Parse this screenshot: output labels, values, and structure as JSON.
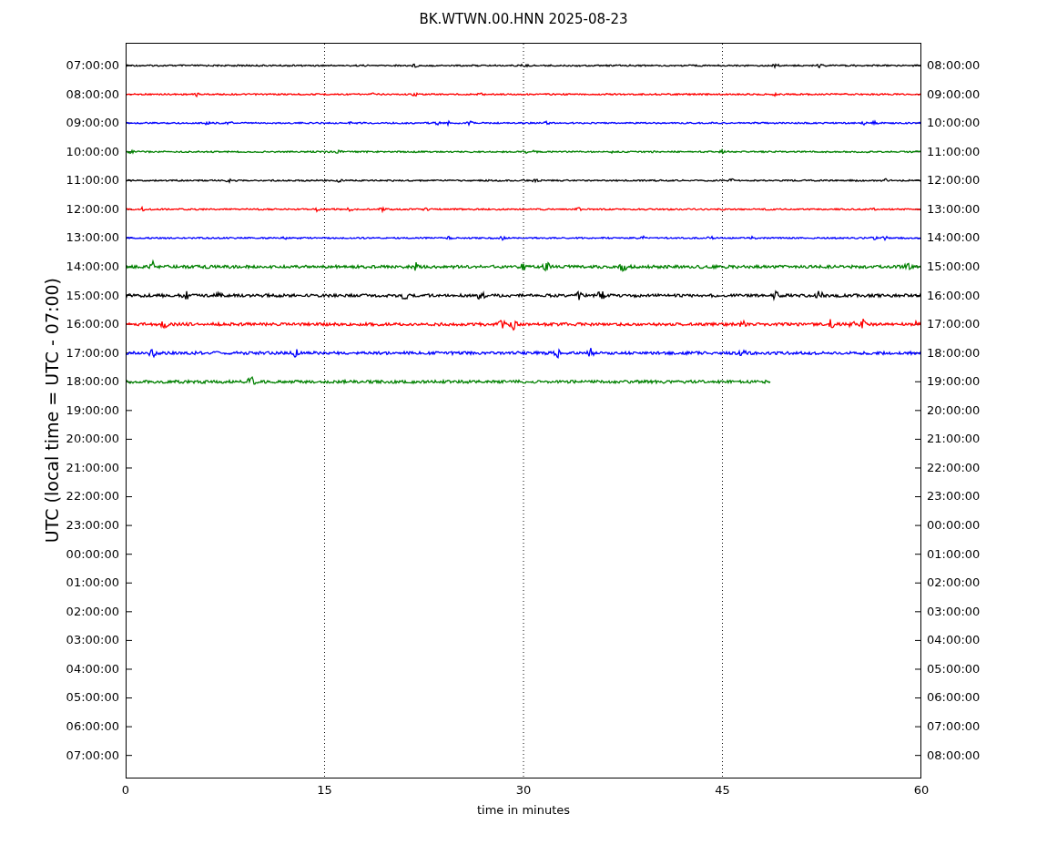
{
  "title": "BK.WTWN.00.HNN 2025-08-23",
  "ylabel": "UTC (local time = UTC - 07:00)",
  "xlabel": "time in minutes",
  "left_ticks": [
    "07:00:00",
    "08:00:00",
    "09:00:00",
    "10:00:00",
    "11:00:00",
    "12:00:00",
    "13:00:00",
    "14:00:00",
    "15:00:00",
    "16:00:00",
    "17:00:00",
    "18:00:00",
    "19:00:00",
    "20:00:00",
    "21:00:00",
    "22:00:00",
    "23:00:00",
    "00:00:00",
    "01:00:00",
    "02:00:00",
    "03:00:00",
    "04:00:00",
    "05:00:00",
    "06:00:00",
    "07:00:00"
  ],
  "right_ticks": [
    "08:00:00",
    "09:00:00",
    "10:00:00",
    "11:00:00",
    "12:00:00",
    "13:00:00",
    "14:00:00",
    "15:00:00",
    "16:00:00",
    "17:00:00",
    "18:00:00",
    "19:00:00",
    "20:00:00",
    "21:00:00",
    "22:00:00",
    "23:00:00",
    "00:00:00",
    "01:00:00",
    "02:00:00",
    "03:00:00",
    "04:00:00",
    "05:00:00",
    "06:00:00",
    "07:00:00",
    "08:00:00"
  ],
  "xticks": [
    "0",
    "15",
    "30",
    "45",
    "60"
  ],
  "traces": [
    {
      "color": "#000000",
      "level": 1
    },
    {
      "color": "#ff0000",
      "level": 1
    },
    {
      "color": "#0000ff",
      "level": 1
    },
    {
      "color": "#008000",
      "level": 1
    },
    {
      "color": "#000000",
      "level": 1
    },
    {
      "color": "#ff0000",
      "level": 1
    },
    {
      "color": "#0000ff",
      "level": 1
    },
    {
      "color": "#008000",
      "level": 1
    },
    {
      "color": "#000000",
      "level": 1
    },
    {
      "color": "#ff0000",
      "level": 1
    },
    {
      "color": "#0000ff",
      "level": 1
    },
    {
      "color": "#008000",
      "level": 0.81
    }
  ]
}
